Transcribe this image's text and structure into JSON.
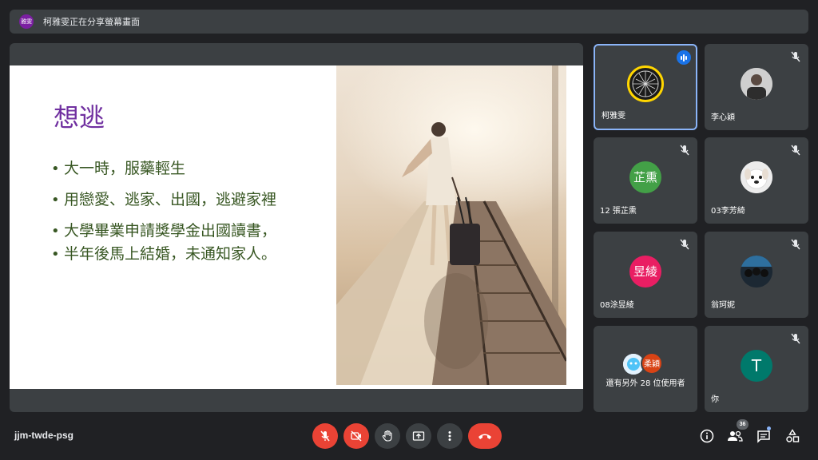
{
  "banner": {
    "avatar_text": "雅雯",
    "text": "柯雅雯正在分享螢幕畫面"
  },
  "slide": {
    "title": "想逃",
    "bullets": [
      "大一時，服藥輕生",
      "用戀愛、逃家、出國，逃避家裡",
      "大學畢業申請獎學金出國讀書，",
      "半年後馬上結婚，未通知家人。"
    ]
  },
  "participants": [
    {
      "name": "柯雅雯",
      "initials": "",
      "color": "#1b1b1b",
      "speaking": true,
      "muted": false
    },
    {
      "name": "李心穎",
      "initials": "",
      "color": "#e0e0e0",
      "speaking": false,
      "muted": true
    },
    {
      "name": "12 張芷熏",
      "initials": "芷熏",
      "color": "#43a047",
      "speaking": false,
      "muted": true
    },
    {
      "name": "03李芳綺",
      "initials": "",
      "color": "#f5f5f5",
      "speaking": false,
      "muted": true
    },
    {
      "name": "08涂昱綾",
      "initials": "昱綾",
      "color": "#e91e63",
      "speaking": false,
      "muted": true
    },
    {
      "name": "翁珂妮",
      "initials": "",
      "color": "#263238",
      "speaking": false,
      "muted": true
    },
    {
      "name": "你",
      "initials": "T",
      "color": "#00796b",
      "speaking": false,
      "muted": true
    }
  ],
  "others": {
    "label": "還有另外 28 位使用者",
    "avatar_text": "柔穎",
    "avatar_color": "#d84315"
  },
  "bottom": {
    "meeting_code": "jjm-twde-psg",
    "people_count": "36"
  },
  "icons": {
    "mic": "mic-off-icon",
    "camera": "camera-off-icon",
    "hand": "raise-hand-icon",
    "present": "present-screen-icon",
    "more": "more-options-icon",
    "end": "end-call-icon",
    "info": "info-icon",
    "people": "people-icon",
    "chat": "chat-icon",
    "activities": "activities-icon"
  },
  "colors": {
    "accent": "#8ab4f8",
    "end_call": "#ea4335",
    "slide_title": "#7030a0",
    "slide_text": "#385723"
  }
}
